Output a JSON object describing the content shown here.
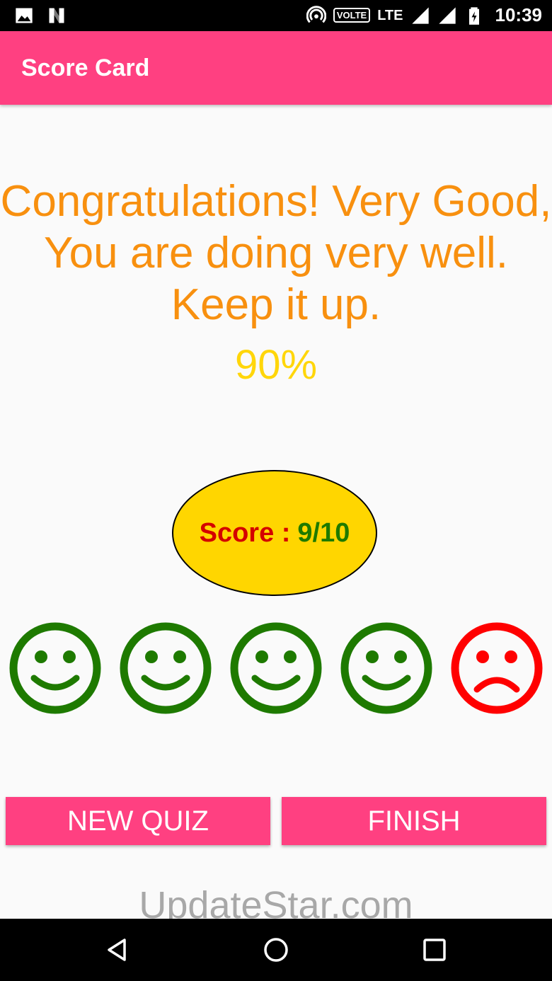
{
  "status_bar": {
    "icons_left": [
      "image-icon",
      "n-icon"
    ],
    "icons_right": [
      "hotspot-icon",
      "volte-badge",
      "lte-icon",
      "signal-icon",
      "signal-icon",
      "battery-icon"
    ],
    "volte": "VOLTE",
    "lte": "LTE",
    "time": "10:39"
  },
  "app_bar": {
    "title": "Score Card",
    "color": "#ff4081"
  },
  "result": {
    "message_line1": "Congratulations! Very Good,",
    "message_line2": "You are doing very well.",
    "message_line3": "Keep it up.",
    "percent": "90%",
    "message_color": "#f8900f",
    "percent_color": "#ffd60a"
  },
  "score": {
    "label": "Score :",
    "value": "9/10",
    "oval_color": "#ffd600",
    "label_color": "#d40000",
    "value_color": "#1e7a00"
  },
  "faces": [
    {
      "type": "smile",
      "color": "#1e7a00"
    },
    {
      "type": "smile",
      "color": "#1e7a00"
    },
    {
      "type": "smile",
      "color": "#1e7a00"
    },
    {
      "type": "smile",
      "color": "#1e7a00"
    },
    {
      "type": "frown",
      "color": "#ff0000"
    }
  ],
  "buttons": {
    "new_quiz": "NEW QUIZ",
    "finish": "FINISH"
  },
  "watermark": "UpdateStar.com",
  "nav_bar": {
    "icons": [
      "back-icon",
      "home-icon",
      "recents-icon"
    ]
  }
}
